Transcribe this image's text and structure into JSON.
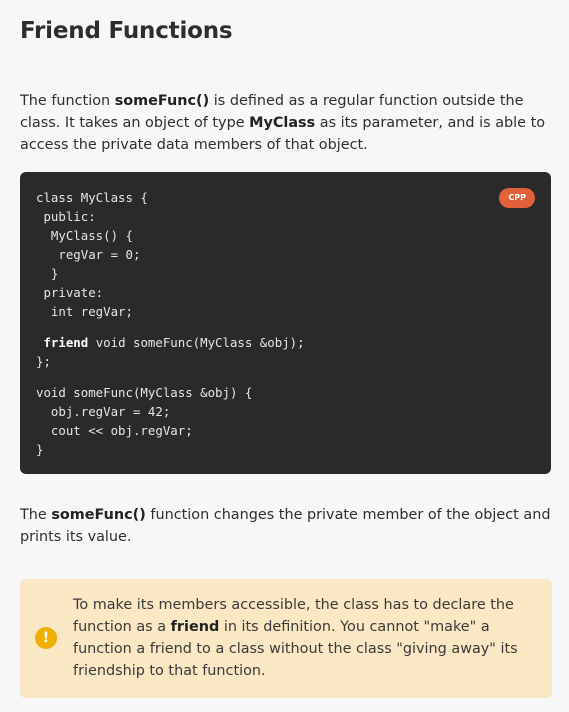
{
  "heading": "Friend Functions",
  "intro": {
    "t1": "The function ",
    "b1": "someFunc()",
    "t2": " is defined as a regular function outside the class. It takes an object of type ",
    "b2": "MyClass",
    "t3": " as its parameter, and is able to access the private data members of that object."
  },
  "code": {
    "language": "CPP",
    "lines": {
      "l1": "class MyClass {",
      "l2": " public:",
      "l3": "  MyClass() {",
      "l4": "   regVar = 0;",
      "l5": "  }",
      "l6": " private:",
      "l7": "  int regVar;",
      "l8_kw": "friend",
      "l8_rest": " void someFunc(MyClass &obj);",
      "l9": "};",
      "l10": "void someFunc(MyClass &obj) {",
      "l11": "  obj.regVar = 42;",
      "l12": "  cout << obj.regVar;",
      "l13": "}"
    }
  },
  "after": {
    "t1": "The ",
    "b1": "someFunc()",
    "t2": " function changes the private member of the object and prints its value."
  },
  "note": {
    "icon": "exclamation-icon",
    "icon_glyph": "!",
    "t1": "To make its members accessible, the class has to declare the function as a ",
    "b1": "friend",
    "t2": " in its definition. You cannot \"make\" a function a friend to a class without the class \"giving away\" its friendship to that function."
  },
  "colors": {
    "background": "#f7f7f7",
    "code_background": "#2a2a2a",
    "badge": "#e0613a",
    "note_background": "#fae7c4",
    "note_icon": "#f0b000"
  }
}
